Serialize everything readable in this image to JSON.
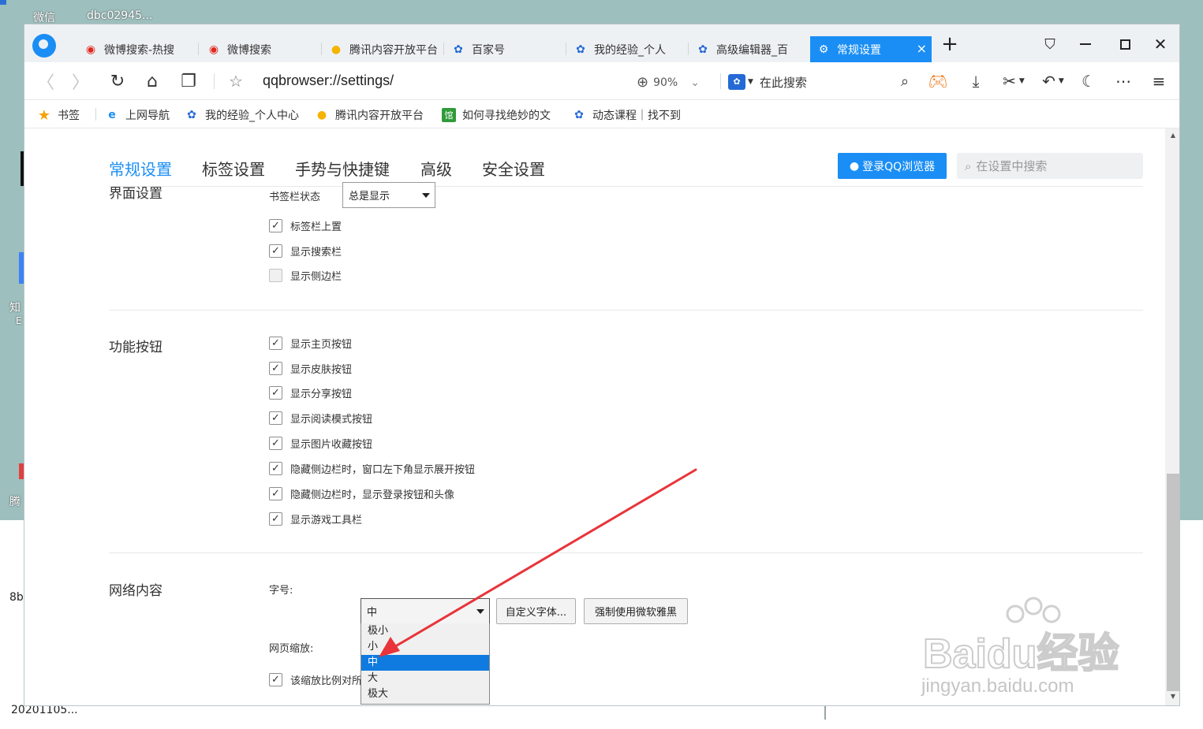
{
  "desktop": {
    "icons": [
      "微信",
      "dbc02945...",
      "知",
      "E",
      "腾",
      "8b",
      "20201105..."
    ]
  },
  "tabs": [
    {
      "label": "微博搜索-热搜",
      "icon": "weibo-icon"
    },
    {
      "label": "微博搜索",
      "icon": "weibo-icon"
    },
    {
      "label": "腾讯内容开放平台",
      "icon": "penguin-icon"
    },
    {
      "label": "百家号",
      "icon": "baidu-paw-icon"
    },
    {
      "label": "我的经验_个人",
      "icon": "baidu-paw-icon"
    },
    {
      "label": "高级编辑器_百",
      "icon": "baidu-paw-icon"
    },
    {
      "label": "常规设置",
      "icon": "gear-icon",
      "active": true,
      "close": "×"
    }
  ],
  "toolbar": {
    "address": "qqbrowser://settings/",
    "zoom": "90%",
    "search_placeholder": "在此搜索",
    "search_engine_icon": "baidu-paw-icon"
  },
  "bookmarks": [
    {
      "label": "书签",
      "icon": "star-icon"
    },
    {
      "label": "上网导航",
      "icon": "ie-icon"
    },
    {
      "label": "我的经验_个人中心",
      "icon": "baidu-paw-icon"
    },
    {
      "label": "腾讯内容开放平台",
      "icon": "penguin-icon"
    },
    {
      "label": "如何寻找绝妙的文",
      "icon": "library-icon"
    },
    {
      "label": "动态课程｜找不到",
      "icon": "baidu-paw-icon"
    }
  ],
  "settings_nav": {
    "tabs": [
      "常规设置",
      "标签设置",
      "手势与快捷键",
      "高级",
      "安全设置"
    ],
    "active": "常规设置",
    "login_button": "登录QQ浏览器",
    "search_placeholder": "在设置中搜索"
  },
  "sections": {
    "interface": {
      "title": "界面设置",
      "bookmark_bar_label": "书签栏状态",
      "bookmark_bar_value": "总是显示",
      "options": [
        {
          "label": "标签栏上置",
          "checked": true
        },
        {
          "label": "显示搜索栏",
          "checked": true
        },
        {
          "label": "显示侧边栏",
          "checked": false
        }
      ]
    },
    "buttons": {
      "title": "功能按钮",
      "options": [
        {
          "label": "显示主页按钮",
          "checked": true
        },
        {
          "label": "显示皮肤按钮",
          "checked": true
        },
        {
          "label": "显示分享按钮",
          "checked": true
        },
        {
          "label": "显示阅读模式按钮",
          "checked": true
        },
        {
          "label": "显示图片收藏按钮",
          "checked": true
        },
        {
          "label": "隐藏侧边栏时，窗口左下角显示展开按钮",
          "checked": true
        },
        {
          "label": "隐藏侧边栏时，显示登录按钮和头像",
          "checked": true
        },
        {
          "label": "显示游戏工具栏",
          "checked": true
        }
      ]
    },
    "web": {
      "title": "网络内容",
      "font_size_label": "字号:",
      "font_size_value": "中",
      "custom_font_button": "自定义字体...",
      "force_yahei_button": "强制使用微软雅黑",
      "zoom_label": "网页缩放:",
      "zoom_checkbox_label": "该缩放比例对所",
      "font_size_options": [
        "极小",
        "小",
        "中",
        "大",
        "极大"
      ],
      "selected_option": "中"
    }
  },
  "watermark": {
    "text": "Baidu经验",
    "sub": "jingyan.baidu.com"
  },
  "colors": {
    "accent": "#1a8ef5",
    "annotation_arrow": "#e8343a",
    "desktop": "#9dbfbd"
  }
}
